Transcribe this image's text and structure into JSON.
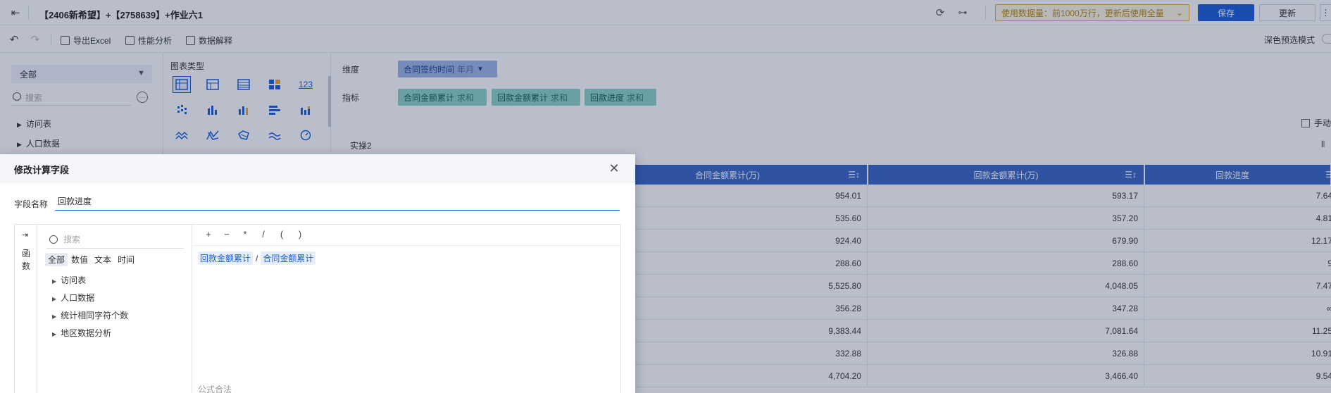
{
  "header": {
    "title": "【2406新希望】+【2758639】+作业六1",
    "notice": "使用数据量：前1000万行，更新后使用全量",
    "save_label": "保存",
    "update_label": "更新"
  },
  "toolbar": {
    "export_label": "导出Excel",
    "perf_label": "性能分析",
    "explain_label": "数据解释",
    "dark_mode_label": "深色预选模式"
  },
  "left_panel": {
    "select_value": "全部",
    "search_placeholder": "搜索",
    "tree": [
      "访问表",
      "人口数据"
    ]
  },
  "chart_types": {
    "title": "图表类型",
    "metric_icon_text": "123"
  },
  "config": {
    "dimension_label": "维度",
    "dimension_pill": {
      "name": "合同签约时间",
      "sub": "年月"
    },
    "measure_label": "指标",
    "measure_pills": [
      {
        "name": "合同金额累计",
        "sub": "求和"
      },
      {
        "name": "回款金额累计",
        "sub": "求和"
      },
      {
        "name": "回款进度",
        "sub": "求和"
      }
    ],
    "manual_label": "手动",
    "sheet_label": "实操2"
  },
  "table": {
    "headers": [
      "合同金额累计(万)",
      "回款金额累计(万)",
      "回款进度"
    ],
    "rows": [
      [
        "954.01",
        "593.17",
        "7.64"
      ],
      [
        "535.60",
        "357.20",
        "4.81"
      ],
      [
        "924.40",
        "679.90",
        "12.17"
      ],
      [
        "288.60",
        "288.60",
        "9"
      ],
      [
        "5,525.80",
        "4,048.05",
        "7.47"
      ],
      [
        "356.28",
        "347.28",
        "∞"
      ],
      [
        "9,383.44",
        "7,081.64",
        "11.25"
      ],
      [
        "332.88",
        "326.88",
        "10.91"
      ],
      [
        "4,704.20",
        "3,466.40",
        "9.54"
      ]
    ]
  },
  "dialog": {
    "title": "修改计算字段",
    "field_name_label": "字段名称",
    "field_name_value": "回款进度",
    "fn_strip_label": "函数",
    "search_placeholder": "搜索",
    "filters": [
      "全部",
      "数值",
      "文本",
      "时间"
    ],
    "tree": [
      "访问表",
      "人口数据",
      "统计相同字符个数",
      "地区数据分析"
    ],
    "operators": [
      "+",
      "−",
      "*",
      "/",
      "(",
      ")"
    ],
    "formula": {
      "left": "回款金额累计",
      "op": "/",
      "right": "合同金额累计"
    },
    "validation": "公式合法"
  },
  "colors": {
    "primary": "#1a5cd7",
    "table_header": "#3a66c4",
    "dimension_pill": "#9fb7e9",
    "measure_pill": "#8fd5c7",
    "notice_border": "#f5a623"
  }
}
